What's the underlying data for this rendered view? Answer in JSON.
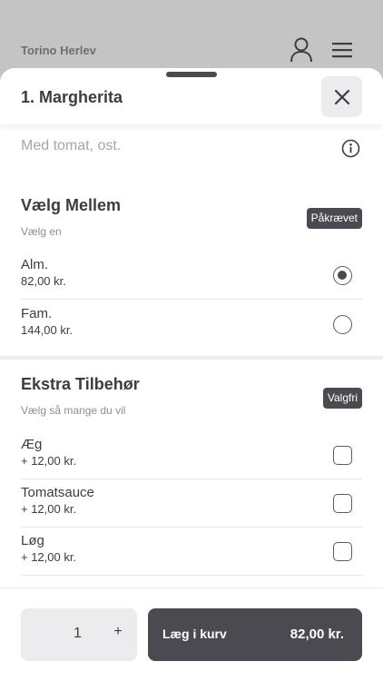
{
  "header": {
    "store_name": "Torino Herlev",
    "user_icon": "user-icon",
    "menu_icon": "hamburger-menu-icon"
  },
  "product": {
    "title": "1. Margherita",
    "description": "Med tomat, ost.",
    "close_icon": "close-icon",
    "info_icon": "info-icon"
  },
  "groups": [
    {
      "title": "Vælg Mellem",
      "subtitle": "Vælg en",
      "badge": "Påkrævet",
      "type": "radio",
      "options": [
        {
          "name": "Alm.",
          "price": "82,00 kr.",
          "selected": true
        },
        {
          "name": "Fam.",
          "price": "144,00 kr.",
          "selected": false
        }
      ]
    },
    {
      "title": "Ekstra Tilbehør",
      "subtitle": "Vælg så mange du vil",
      "badge": "Valgfri",
      "type": "checkbox",
      "options": [
        {
          "name": "Æg",
          "price": "+ 12,00 kr.",
          "selected": false
        },
        {
          "name": "Tomatsauce",
          "price": "+ 12,00 kr.",
          "selected": false
        },
        {
          "name": "Løg",
          "price": "+ 12,00 kr.",
          "selected": false
        }
      ]
    }
  ],
  "footer": {
    "quantity": "1",
    "plus": "+",
    "add_to_cart_label": "Læg i kurv",
    "total_price": "82,00 kr."
  },
  "colors": {
    "primary": "#4a4a50",
    "backdrop": "#c4c4c4",
    "muted_text": "#a7a7ab"
  }
}
